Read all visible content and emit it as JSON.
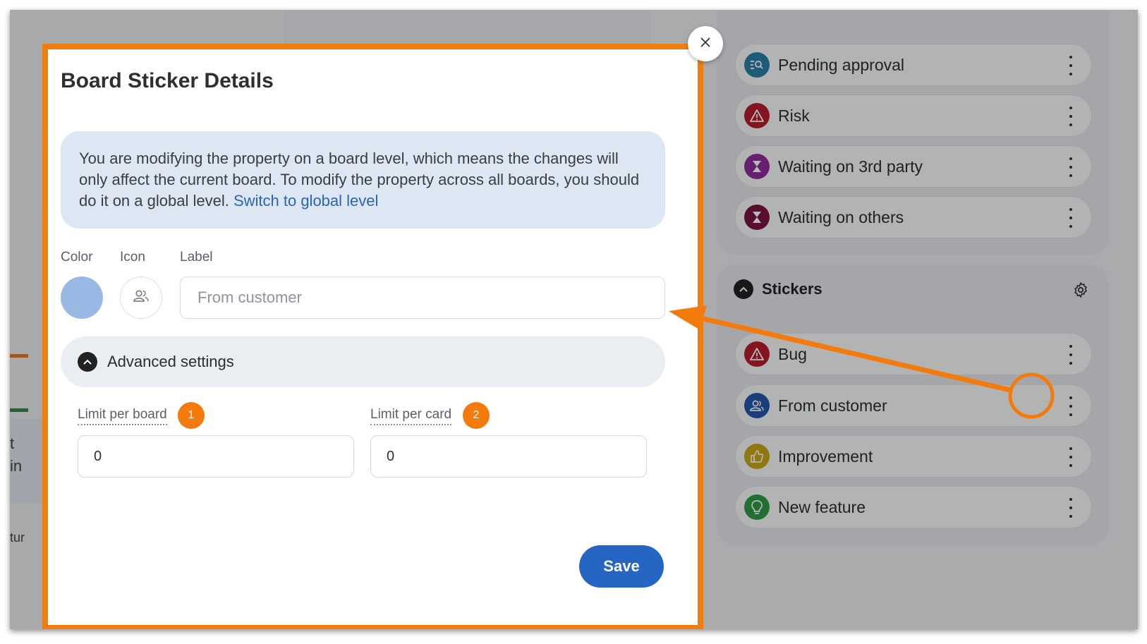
{
  "background": {
    "fragments": [
      "t",
      "in",
      "tur"
    ]
  },
  "right_panel": {
    "top_items": [
      {
        "label": "Pending approval",
        "icon": "search-list-icon",
        "color": "#2a7fa8"
      },
      {
        "label": "Risk",
        "icon": "warning-icon",
        "color": "#b81d2b"
      },
      {
        "label": "Waiting on 3rd party",
        "icon": "hourglass-icon",
        "color": "#8c2f9b"
      },
      {
        "label": "Waiting on others",
        "icon": "hourglass-icon",
        "color": "#7a1443"
      }
    ],
    "stickers_title": "Stickers",
    "sticker_items": [
      {
        "label": "Bug",
        "icon": "warning-icon",
        "color": "#b81d2b"
      },
      {
        "label": "From customer",
        "icon": "people-icon",
        "color": "#2356a8"
      },
      {
        "label": "Improvement",
        "icon": "thumbs-up-icon",
        "color": "#c9a516"
      },
      {
        "label": "New feature",
        "icon": "lightbulb-icon",
        "color": "#2f9a45"
      }
    ]
  },
  "modal": {
    "title": "Board Sticker Details",
    "info_text": "You are modifying the property on a board level, which means the changes will only affect the current board. To modify the property across all boards, you should do it on a global level.",
    "info_link": "Switch to global level",
    "color_label": "Color",
    "icon_label": "Icon",
    "label_label": "Label",
    "label_placeholder": "From customer",
    "selected_color": "#9ab8e4",
    "advanced_label": "Advanced settings",
    "limit_board_label": "Limit per board",
    "limit_board_value": "0",
    "limit_card_label": "Limit per card",
    "limit_card_value": "0",
    "save_label": "Save"
  },
  "annotations": {
    "badge1": "1",
    "badge2": "2",
    "accent": "#f07e0f"
  }
}
